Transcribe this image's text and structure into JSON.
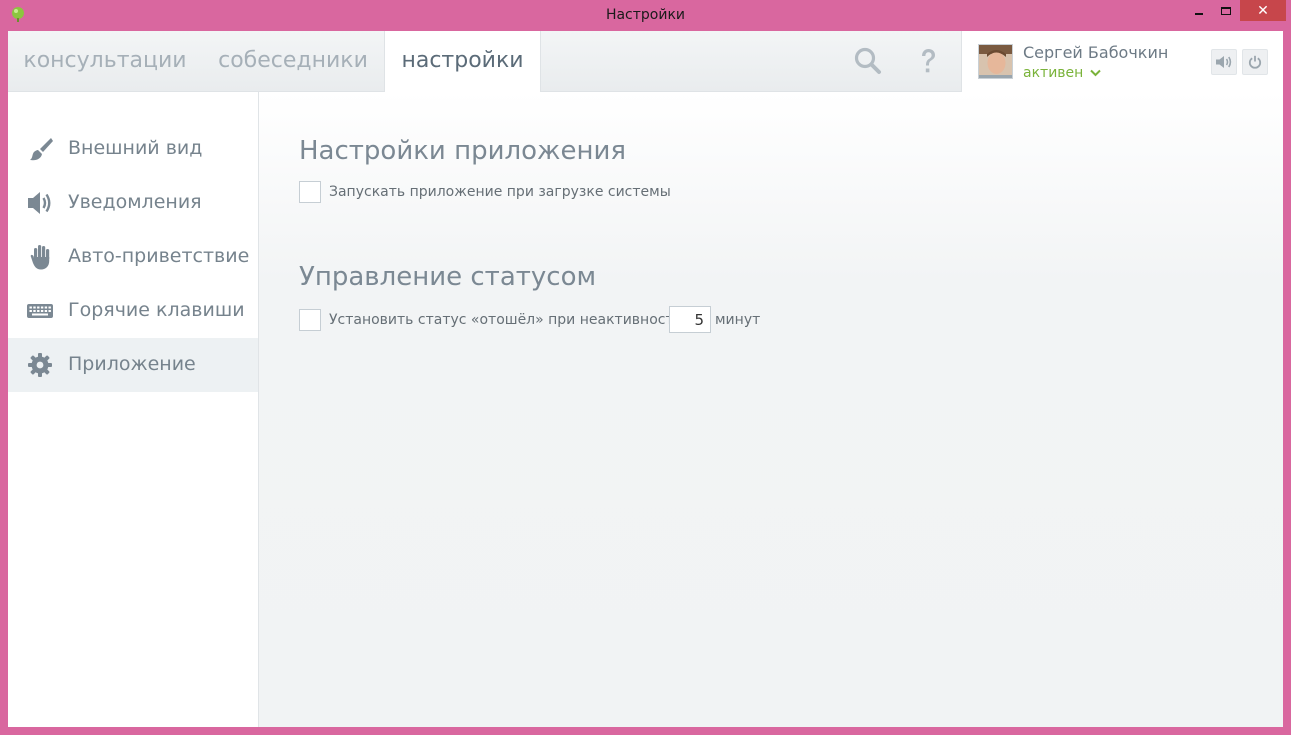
{
  "window": {
    "title": "Настройки",
    "close_glyph": "✕"
  },
  "tabs": [
    {
      "label": "консультации"
    },
    {
      "label": "собеседники"
    },
    {
      "label": "настройки",
      "active": true
    }
  ],
  "user": {
    "name": "Сергей Бабочкин",
    "status": "активен",
    "status_color": "#7ab33a"
  },
  "sidebar": {
    "items": [
      {
        "label": "Внешний вид",
        "icon": "brush-icon"
      },
      {
        "label": "Уведомления",
        "icon": "speaker-icon"
      },
      {
        "label": "Авто-приветствие",
        "icon": "hand-icon"
      },
      {
        "label": "Горячие клавиши",
        "icon": "keyboard-icon"
      },
      {
        "label": "Приложение",
        "icon": "gear-icon",
        "active": true
      }
    ]
  },
  "main": {
    "app_settings_title": "Настройки приложения",
    "autostart_label": "Запускать приложение при загрузке системы",
    "status_title": "Управление статусом",
    "away_label": "Установить статус «отошёл» при неактивности",
    "away_minutes": "5",
    "minutes_unit": "минут"
  },
  "colors": {
    "window_frame": "#d9679f",
    "close_button": "#c7464b",
    "accent_text": "#5b6b78"
  }
}
